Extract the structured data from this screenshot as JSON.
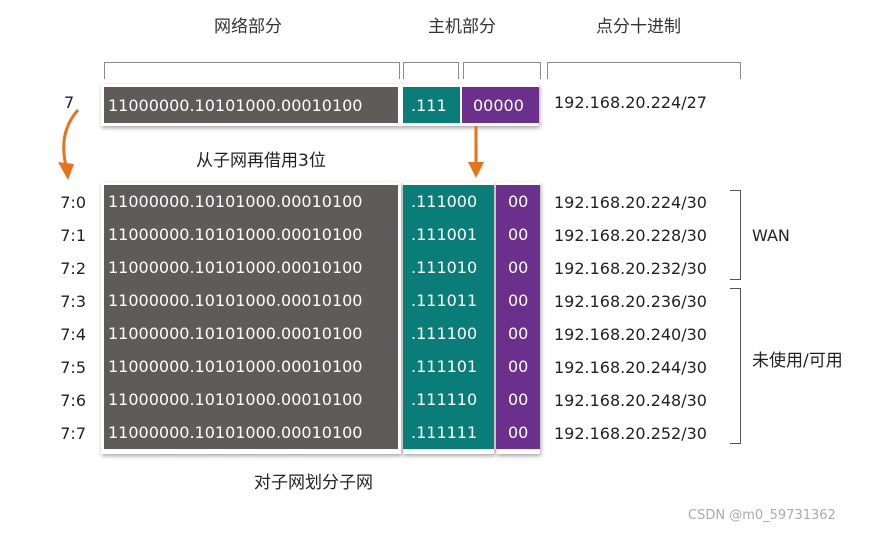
{
  "headers": {
    "network": "网络部分",
    "host": "主机部分",
    "decimal": "点分十进制"
  },
  "top_row": {
    "label": "7",
    "network_bits": "11000000.10101000.00010100",
    "host_bits": ".111",
    "extra_bits": "00000",
    "decimal": "192.168.20.224/27"
  },
  "borrow_caption": "从子网再借用3位",
  "rows": [
    {
      "label": "7:0",
      "network_bits": "11000000.10101000.00010100",
      "host_bits": ".111000",
      "extra_bits": "00",
      "decimal": "192.168.20.224/30"
    },
    {
      "label": "7:1",
      "network_bits": "11000000.10101000.00010100",
      "host_bits": ".111001",
      "extra_bits": "00",
      "decimal": "192.168.20.228/30"
    },
    {
      "label": "7:2",
      "network_bits": "11000000.10101000.00010100",
      "host_bits": ".111010",
      "extra_bits": "00",
      "decimal": "192.168.20.232/30"
    },
    {
      "label": "7:3",
      "network_bits": "11000000.10101000.00010100",
      "host_bits": ".111011",
      "extra_bits": "00",
      "decimal": "192.168.20.236/30"
    },
    {
      "label": "7:4",
      "network_bits": "11000000.10101000.00010100",
      "host_bits": ".111100",
      "extra_bits": "00",
      "decimal": "192.168.20.240/30"
    },
    {
      "label": "7:5",
      "network_bits": "11000000.10101000.00010100",
      "host_bits": ".111101",
      "extra_bits": "00",
      "decimal": "192.168.20.244/30"
    },
    {
      "label": "7:6",
      "network_bits": "11000000.10101000.00010100",
      "host_bits": ".111110",
      "extra_bits": "00",
      "decimal": "192.168.20.248/30"
    },
    {
      "label": "7:7",
      "network_bits": "11000000.10101000.00010100",
      "host_bits": ".111111",
      "extra_bits": "00",
      "decimal": "192.168.20.252/30"
    }
  ],
  "groups": {
    "wan": "WAN",
    "unused": "未使用/可用"
  },
  "bottom_caption": "对子网划分子网",
  "watermark": "CSDN @m0_59731362",
  "colors": {
    "network": "#605b5b",
    "host": "#0b7d78",
    "extra": "#6b2f8c",
    "arrow": "#e8731e"
  }
}
